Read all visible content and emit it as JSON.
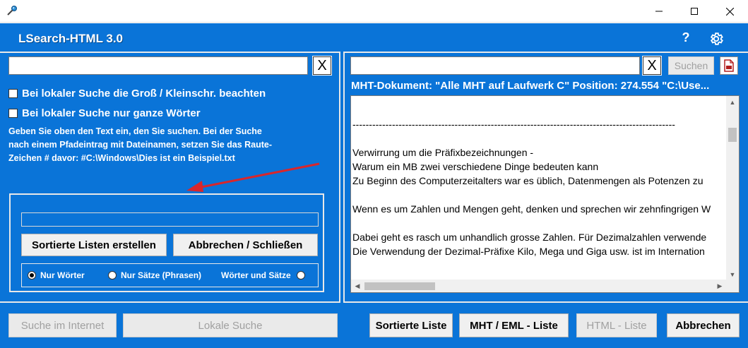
{
  "app": {
    "title": "LSearch-HTML 3.0"
  },
  "window": {
    "minimize_glyph": "—",
    "maximize_glyph": "☐",
    "close_glyph": "✕"
  },
  "icons": {
    "app": "pin-icon",
    "help": "help-icon",
    "settings": "gear-icon",
    "pdf": "pdf-icon"
  },
  "left": {
    "search_value": "",
    "clear_label": "X",
    "case_label": "Bei lokaler Suche die Groß / Kleinschr. beachten",
    "case_checked": false,
    "whole_label": "Bei lokaler Suche nur ganze Wörter",
    "whole_checked": false,
    "info_line1": "Geben Sie oben den Text ein, den Sie suchen.   Bei der Suche",
    "info_line2": "nach einem Pfadeintrag mit Dateinamen, setzen Sie das Raute-",
    "info_line3": "Zeichen # davor:      #C:\\Windows\\Dies ist ein Beispiel.txt",
    "progress": 0,
    "btn_sort": "Sortierte Listen erstellen",
    "btn_cancel": "Abbrechen / Schließen",
    "radio_words": "Nur Wörter",
    "radio_phrases": "Nur Sätze (Phrasen)",
    "radio_both": "Wörter und Sätze",
    "radio_selected": "words"
  },
  "right": {
    "search_value": "",
    "clear_label": "X",
    "search_btn": "Suchen",
    "status": "MHT-Dokument: \"Alle MHT auf Laufwerk C\"  Position: 274.554  \"C:\\Use...",
    "lines": [
      "",
      "--------------------------------------------------------------------------------------------------",
      "",
      "Verwirrung um die Präfixbezeichnungen -",
      "Warum ein MB zwei verschiedene Dinge bedeuten kann",
      "Zu Beginn des Computerzeitalters war es üblich, Datenmengen als Potenzen zu",
      "",
      "Wenn es um Zahlen und Mengen geht, denken und sprechen wir zehnfingrigen W",
      "",
      "Dabei geht es rasch um unhandlich grosse Zahlen. Für Dezimalzahlen verwende",
      "Die Verwendung der Dezimal-Präfixe Kilo, Mega und Giga usw. ist im Internation"
    ]
  },
  "bottom": {
    "btn_internet": "Suche im Internet",
    "btn_local": "Lokale Suche",
    "btn_sorted": "Sortierte Liste",
    "btn_mht": "MHT / EML - Liste",
    "btn_html": "HTML - Liste",
    "btn_exit": "Abbrechen"
  },
  "colors": {
    "accent": "#0a74d8",
    "arrow": "#d9262b"
  }
}
